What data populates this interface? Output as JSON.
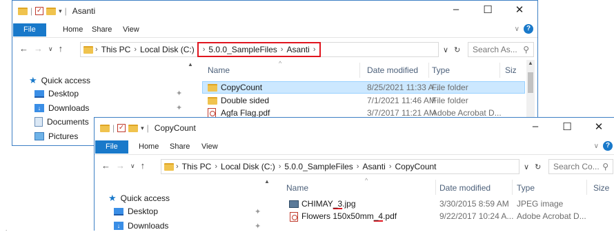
{
  "window_back": {
    "title": "Asanti",
    "ribbon_tabs": [
      "File",
      "Home",
      "Share",
      "View"
    ],
    "controls": {
      "minimize": "–",
      "maximize": "☐",
      "close": "✕"
    },
    "breadcrumb": {
      "this_pc": "This PC",
      "disk": "Local Disk (C:)",
      "folder1": "5.0.0_SampleFiles",
      "folder2": "Asanti"
    },
    "search_placeholder": "Search As...",
    "nav": {
      "quick_access": "Quick access",
      "desktop": "Desktop",
      "downloads": "Downloads",
      "documents": "Documents",
      "pictures": "Pictures"
    },
    "columns": {
      "name": "Name",
      "date": "Date modified",
      "type": "Type",
      "size": "Siz"
    },
    "files": [
      {
        "name": "CopyCount",
        "date": "8/25/2021 11:33 A...",
        "type": "File folder",
        "icon": "folder-icon",
        "selected": true
      },
      {
        "name": "Double sided",
        "date": "7/1/2021 11:46 AM",
        "type": "File folder",
        "icon": "folder-icon",
        "selected": false
      },
      {
        "name": "Agfa Flag.pdf",
        "date": "3/7/2017 11:21 AM",
        "type": "Adobe Acrobat D...",
        "icon": "pdf-icon",
        "selected": false
      }
    ]
  },
  "window_front": {
    "title": "CopyCount",
    "ribbon_tabs": [
      "File",
      "Home",
      "Share",
      "View"
    ],
    "controls": {
      "minimize": "–",
      "maximize": "☐",
      "close": "✕"
    },
    "breadcrumb": {
      "this_pc": "This PC",
      "disk": "Local Disk (C:)",
      "folder1": "5.0.0_SampleFiles",
      "folder2": "Asanti",
      "folder3": "CopyCount"
    },
    "search_placeholder": "Search Co...",
    "nav": {
      "quick_access": "Quick access",
      "desktop": "Desktop",
      "downloads": "Downloads"
    },
    "columns": {
      "name": "Name",
      "date": "Date modified",
      "type": "Type",
      "size": "Size"
    },
    "files": [
      {
        "name_plain": "CHIMAY",
        "name_ul": "_3",
        "name_rest": ".jpg",
        "date": "3/30/2015 8:59 AM",
        "type": "JPEG image",
        "icon": "image-icon"
      },
      {
        "name_plain": "Flowers 150x50mm",
        "name_ul": "_4",
        "name_rest": ".pdf",
        "date": "9/22/2017 10:24 A...",
        "type": "Adobe Acrobat D...",
        "icon": "pdf-icon"
      }
    ]
  },
  "edge_mark": "."
}
